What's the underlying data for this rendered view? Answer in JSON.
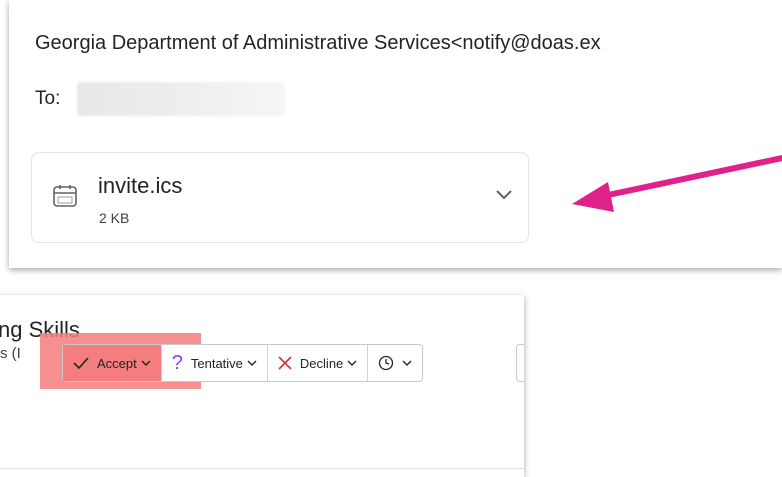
{
  "email": {
    "sender": "Georgia Department of Administrative Services<notify@doas.ex",
    "to_label": "To:",
    "attachment": {
      "name": "invite.ics",
      "size": "2 KB",
      "icon": "calendar-icon"
    }
  },
  "meeting": {
    "title_fragment": "ng Skills",
    "left_fragment": "s (I",
    "actions": [
      {
        "label": "Accept",
        "icon": "checkmark-icon"
      },
      {
        "label": "Tentative",
        "icon": "question-icon"
      },
      {
        "label": "Decline",
        "icon": "close-icon"
      },
      {
        "label": "",
        "icon": "clock-icon"
      }
    ]
  },
  "colors": {
    "highlight": "#f47d7d",
    "arrow": "#e0218a",
    "tentative_icon": "#8a3ffc",
    "decline_icon": "#d13438"
  }
}
